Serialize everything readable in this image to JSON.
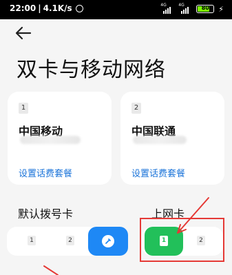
{
  "status_bar": {
    "time": "22:00",
    "speed": "4.1K/s",
    "network_tag_1": "4G",
    "network_tag_2": "4G",
    "battery": "80",
    "icons": [
      "alarm-icon",
      "signal-icon",
      "battery-icon",
      "charging-icon"
    ]
  },
  "header": {
    "back_icon": "arrow-left-icon",
    "title": "双卡与移动网络"
  },
  "sim_cards": [
    {
      "slot": "1",
      "carrier": "中国移动",
      "plan_link": "设置话费套餐"
    },
    {
      "slot": "2",
      "carrier": "中国联通",
      "plan_link": "设置话费套餐"
    }
  ],
  "default_dial": {
    "label": "默认拨号卡",
    "options": [
      "1",
      "2"
    ],
    "selected_icon": "dial-icon"
  },
  "data_card": {
    "label": "上网卡",
    "selected": "1",
    "other": "2"
  },
  "colors": {
    "accent_blue": "#1e88f5",
    "accent_green": "#22c05a",
    "link_blue": "#1a73d9",
    "annotation_red": "#e53935"
  }
}
